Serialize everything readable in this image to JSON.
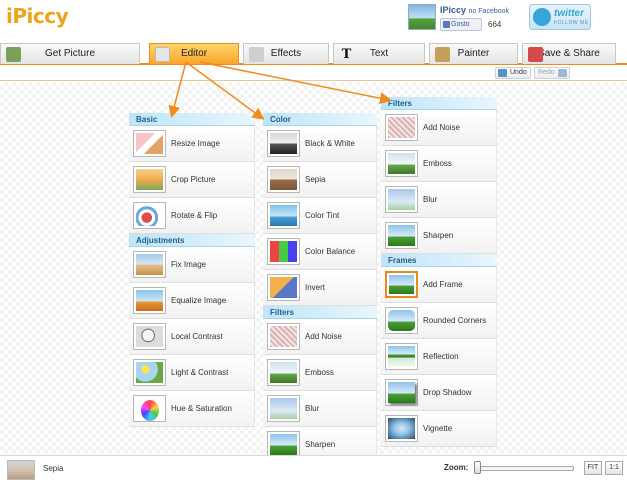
{
  "header": {
    "logo": "iPiccy",
    "facebook": {
      "name": "IPiccy",
      "suffix": "no Facebook",
      "like_label": "Gosto",
      "count": "664"
    },
    "twitter": {
      "label": "twitter",
      "sub": "FOLLOW ME"
    }
  },
  "tabs": [
    {
      "label": "Get Picture",
      "icon": "download-picture-icon",
      "active": false
    },
    {
      "label": "Editor",
      "icon": "editor-tools-icon",
      "active": true
    },
    {
      "label": "Effects",
      "icon": "effects-icon",
      "active": false
    },
    {
      "label": "Text",
      "icon": "text-t-icon",
      "active": false
    },
    {
      "label": "Painter",
      "icon": "paint-brush-icon",
      "active": false
    },
    {
      "label": "Save & Share",
      "icon": "save-disk-icon",
      "active": false
    }
  ],
  "toolbar": {
    "undo_label": "Undo",
    "redo_label": "Redo"
  },
  "columns": {
    "col1": [
      {
        "header": "Basic",
        "items": [
          "Resize Image",
          "Crop Picture",
          "Rotate & Flip"
        ]
      },
      {
        "header": "Adjustments",
        "items": [
          "Fix Image",
          "Equalize Image",
          "Local Contrast",
          "Light & Contrast",
          "Hue & Saturation"
        ]
      }
    ],
    "col2": [
      {
        "header": "Color",
        "items": [
          "Black & White",
          "Sepia",
          "Color Tint",
          "Color Balance",
          "Invert"
        ]
      },
      {
        "header": "Filters",
        "items": [
          "Add Noise",
          "Emboss",
          "Blur",
          "Sharpen"
        ]
      }
    ],
    "col3": [
      {
        "header": "Filters",
        "items": [
          "Add Noise",
          "Emboss",
          "Blur",
          "Sharpen"
        ]
      },
      {
        "header": "Frames",
        "items": [
          "Add Frame",
          "Rounded Corners",
          "Reflection",
          "Drop Shadow",
          "Vignette"
        ]
      }
    ]
  },
  "bottom": {
    "current_label": "Sepia",
    "zoom_label": "Zoom:",
    "fit_label": "FIT",
    "actual_label": "1:1"
  },
  "colors": {
    "accent": "#f28a1c",
    "section": "#bfe4f8",
    "link": "#3b5998"
  }
}
